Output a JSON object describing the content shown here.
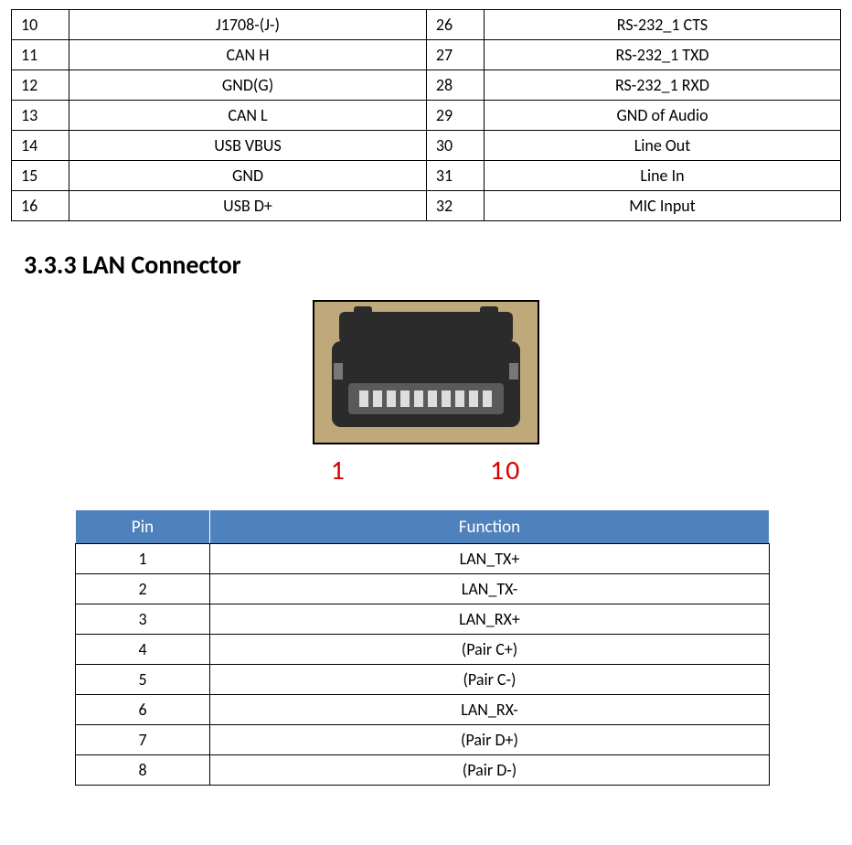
{
  "top_table": {
    "rows": [
      {
        "pinL": "10",
        "funcL": "J1708-(J-)",
        "pinR": "26",
        "funcR": "RS-232_1 CTS"
      },
      {
        "pinL": "11",
        "funcL": "CAN H",
        "pinR": "27",
        "funcR": "RS-232_1 TXD"
      },
      {
        "pinL": "12",
        "funcL": "GND(G)",
        "pinR": "28",
        "funcR": "RS-232_1 RXD"
      },
      {
        "pinL": "13",
        "funcL": "CAN L",
        "pinR": "29",
        "funcR": "GND of Audio"
      },
      {
        "pinL": "14",
        "funcL": "USB VBUS",
        "pinR": "30",
        "funcR": "Line Out"
      },
      {
        "pinL": "15",
        "funcL": "GND",
        "pinR": "31",
        "funcR": "Line In"
      },
      {
        "pinL": "16",
        "funcL": "USB D+",
        "pinR": "32",
        "funcR": "MIC Input"
      }
    ]
  },
  "section_heading": "3.3.3   LAN Connector",
  "connector_labels": {
    "left": "1",
    "right": "10"
  },
  "lan_table": {
    "headers": {
      "pin": "Pin",
      "func": "Function"
    },
    "rows": [
      {
        "pin": "1",
        "func": "LAN_TX+"
      },
      {
        "pin": "2",
        "func": "LAN_TX-"
      },
      {
        "pin": "3",
        "func": "LAN_RX+"
      },
      {
        "pin": "4",
        "func": "(Pair C+)"
      },
      {
        "pin": "5",
        "func": "(Pair C-)"
      },
      {
        "pin": "6",
        "func": "LAN_RX-"
      },
      {
        "pin": "7",
        "func": "(Pair D+)"
      },
      {
        "pin": "8",
        "func": "(Pair D-)"
      }
    ]
  }
}
